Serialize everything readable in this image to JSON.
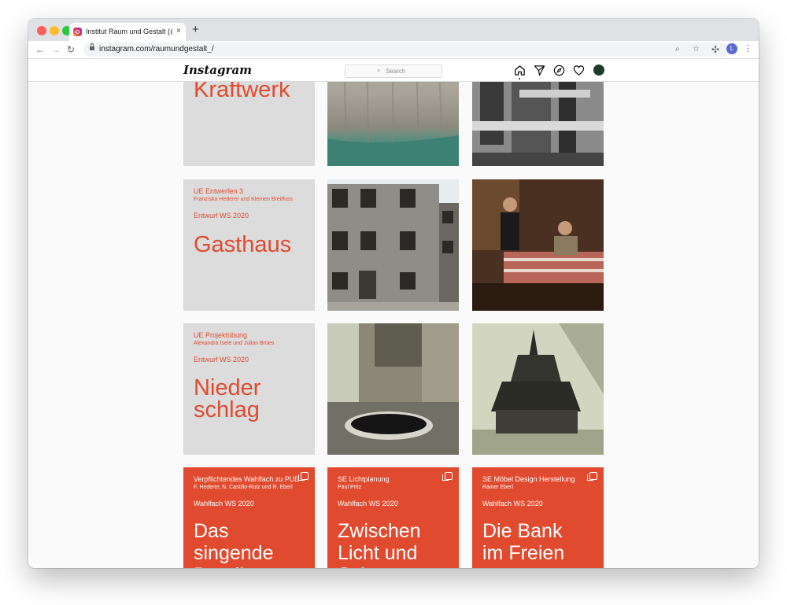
{
  "browser": {
    "tab_title": "Institut Raum und Gestalt (@raumundgestalt_)",
    "tab_close": "×",
    "new_tab": "+",
    "url": "instagram.com/raumundgestalt_/",
    "profile_initial": "L"
  },
  "instagram": {
    "logo": "Instagram",
    "search_placeholder": "Search"
  },
  "posts_row1": {
    "title": "Kraftwerk"
  },
  "posts": [
    {
      "course": "UE Entwerfen 3",
      "people": "Franziska Hederer und Klemen Breitfuss",
      "term": "Entwurf WS 2020",
      "title": "Gasthaus"
    },
    {
      "course": "UE Projektübung",
      "people": "Alexandra Isele und Julian Brües",
      "term": "Entwurf WS 2020",
      "title": "Nieder schlag"
    },
    {
      "course": "Verpflichtendes Wahlfach zu PUE",
      "people": "F. Hederer, N. Castillo-Rutz und R. Eberl",
      "term": "Wahlfach WS 2020",
      "title": "Das singende Detail"
    },
    {
      "course": "SE Lichtplanung",
      "people": "Paul Pritz",
      "term": "Wahlfach WS 2020",
      "title": "Zwischen Licht und Schatten"
    },
    {
      "course": "SE Möbel Design Herstellung",
      "people": "Rainer Eberl",
      "term": "Wahlfach WS 2020",
      "title": "Die Bank im Freien"
    }
  ],
  "colors": {
    "brand_orange": "#e04a2e",
    "card_gray": "#dcdcdc"
  }
}
